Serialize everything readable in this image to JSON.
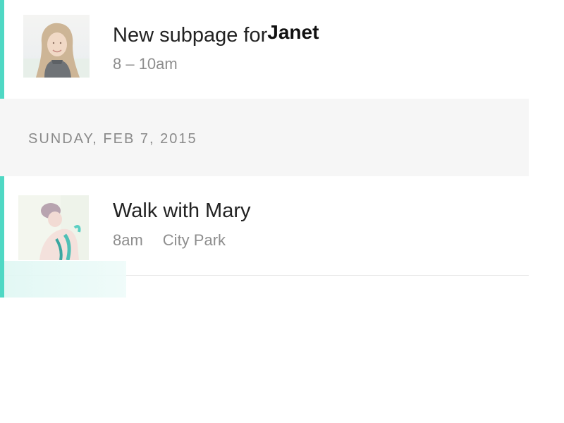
{
  "colors": {
    "accent": "#4fd8c4",
    "day_header_bg": "#f6f6f6",
    "muted_text": "#8e8e8e"
  },
  "events": [
    {
      "title": "New subpage for",
      "name": "Janet",
      "time": "8 – 10am",
      "location": "",
      "avatar_icon": "woman-smiling-avatar"
    },
    {
      "title": "Walk with Mary",
      "name": "",
      "time": "8am",
      "location": "City Park",
      "avatar_icon": "woman-stretching-avatar"
    }
  ],
  "day_header": {
    "label": "SUNDAY, FEB 7, 2015"
  }
}
